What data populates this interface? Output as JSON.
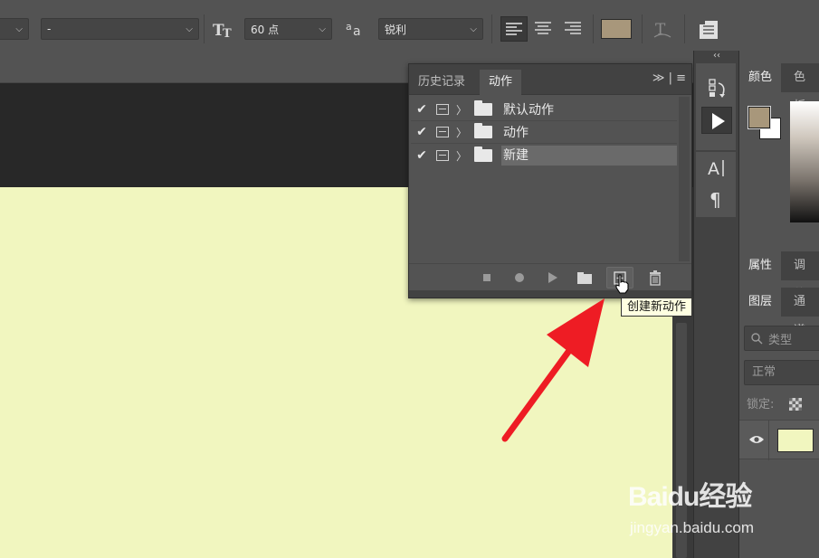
{
  "options_bar": {
    "font_style_value": "-",
    "font_size_value": "60 点",
    "antialias_value": "锐利",
    "swatch_color": "#a8977b"
  },
  "actions_panel": {
    "tabs": [
      {
        "label": "历史记录",
        "active": false
      },
      {
        "label": "动作",
        "active": true
      }
    ],
    "menu_glyph": "≫ | ≡",
    "rows": [
      {
        "check": "✔",
        "label": "默认动作",
        "selected": false
      },
      {
        "check": "✔",
        "label": "动作",
        "selected": false
      },
      {
        "check": "✔",
        "label": "新建",
        "selected": true
      }
    ],
    "buttons": [
      "stop-icon",
      "record-icon",
      "play-icon",
      "new-set-icon",
      "new-action-icon",
      "trash-icon"
    ],
    "tooltip": "创建新动作"
  },
  "mini_strip": {
    "collapse_glyph": "‹‹",
    "buttons": [
      "history-icon",
      "actions-play-icon",
      "character-icon",
      "paragraph-icon"
    ]
  },
  "right_dock": {
    "color_tabs": [
      "颜色",
      "色板"
    ],
    "props_tabs": [
      "属性",
      "调整"
    ],
    "layers_tabs": [
      "图层",
      "通道"
    ],
    "search_placeholder": "类型",
    "blend_mode": "正常",
    "lock_label": "锁定:",
    "fg_color": "#a8977b",
    "bg_color": "#ffffff",
    "layer_thumb_color": "#f1f6bf"
  },
  "canvas": {
    "fill_color": "#f1f6bf"
  },
  "watermark": {
    "brand": "Baidu经验",
    "url": "jingyan.baidu.com"
  }
}
